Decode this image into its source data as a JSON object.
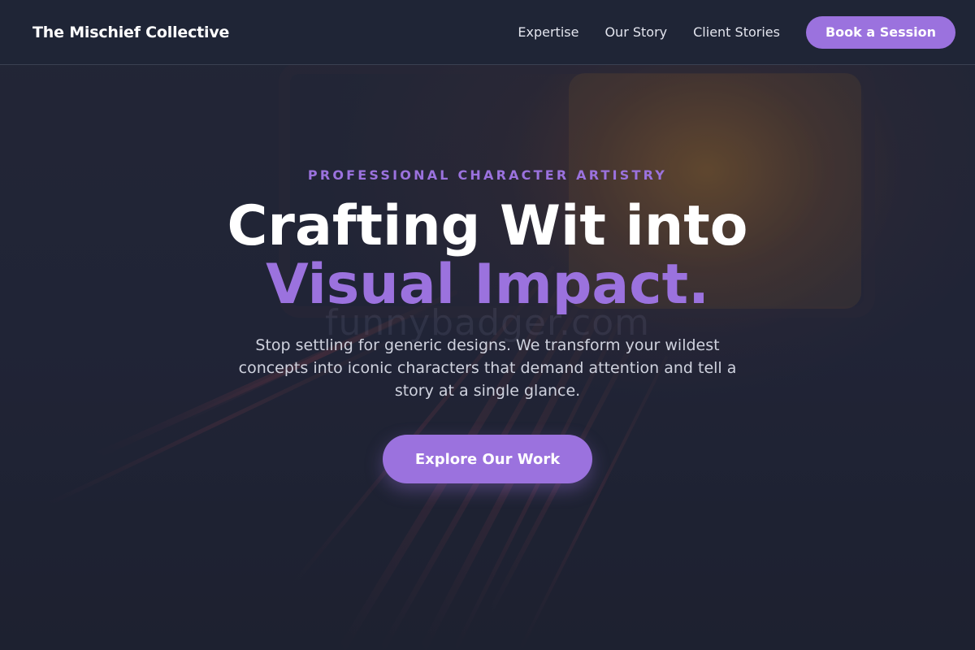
{
  "brand": {
    "name": "The Mischief Collective"
  },
  "nav": {
    "links": [
      "Expertise",
      "Our Story",
      "Client Stories"
    ],
    "cta_label": "Book a Session"
  },
  "hero": {
    "eyebrow": "PROFESSIONAL CHARACTER ARTISTRY",
    "headline_line1": "Crafting Wit into",
    "headline_line2": "Visual Impact.",
    "subtext": "Stop settling for generic designs. We transform your wildest concepts into iconic characters that demand attention and tell a story at a single glance.",
    "cta_label": "Explore Our Work",
    "watermark": "funnybadger.com"
  },
  "colors": {
    "accent": "#9b72de",
    "navbar_bg": "#1f2536",
    "hero_bg": "#232738",
    "text_primary": "#ffffff",
    "text_secondary": "#cfd2de"
  }
}
